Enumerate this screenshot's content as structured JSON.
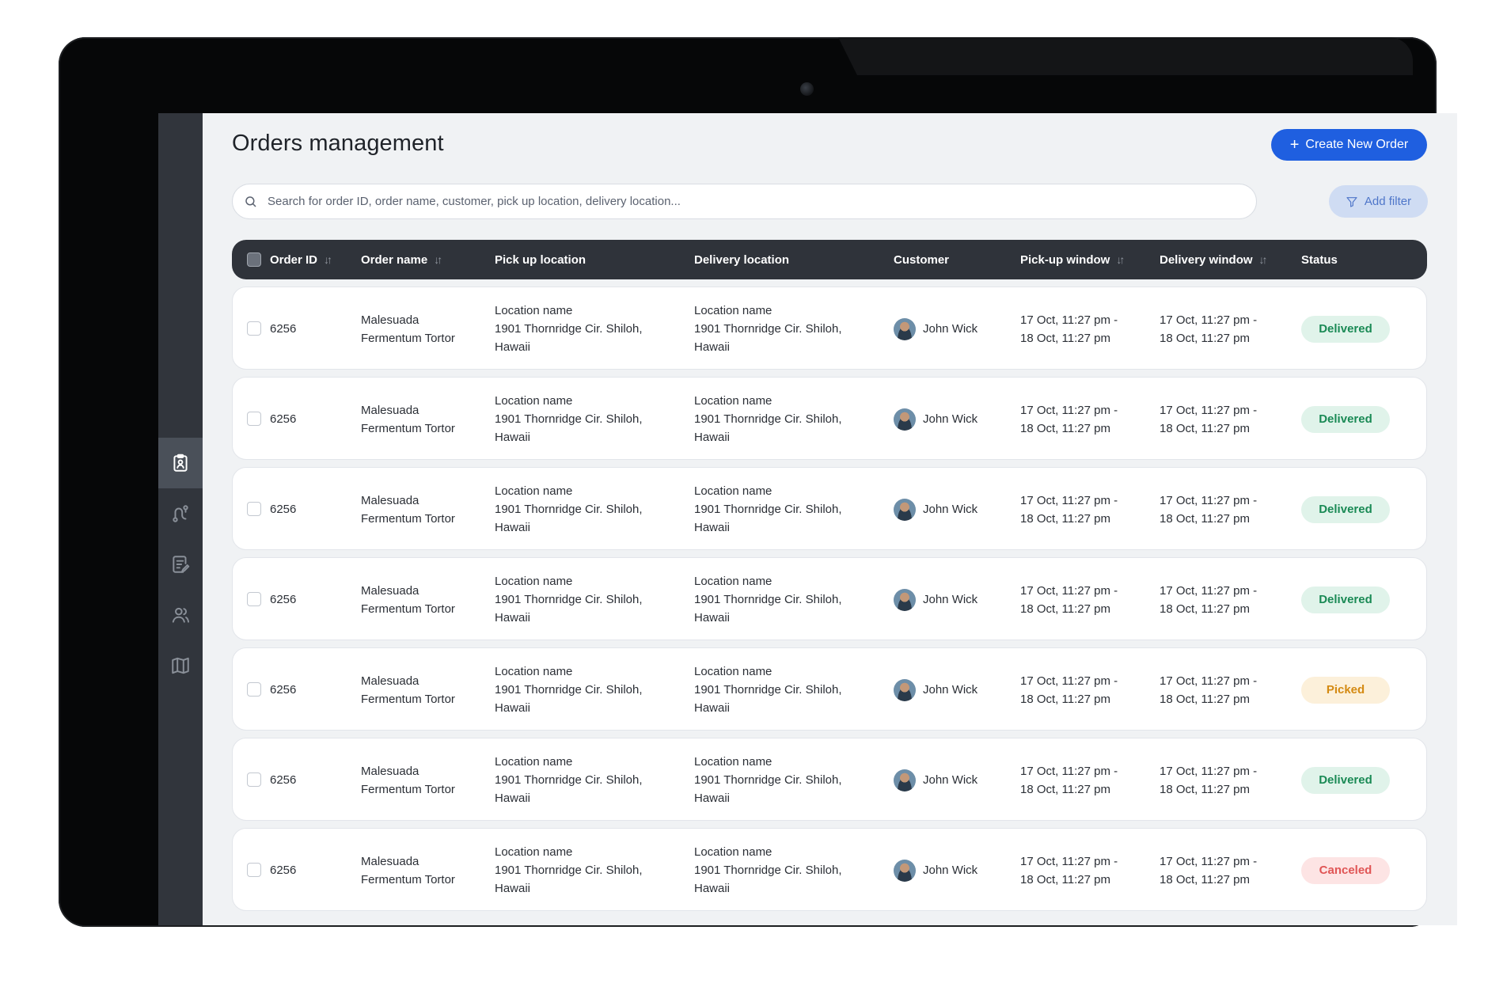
{
  "page": {
    "title": "Orders management",
    "create_button": "Create New Order",
    "search_placeholder": "Search for order ID, order name, customer, pick up location, delivery location...",
    "filter_button": "Add filter"
  },
  "sidebar": {
    "items": [
      {
        "icon": "clipboard-user-icon",
        "active": true
      },
      {
        "icon": "route-icon",
        "active": false
      },
      {
        "icon": "edit-document-icon",
        "active": false
      },
      {
        "icon": "users-icon",
        "active": false
      },
      {
        "icon": "map-icon",
        "active": false
      }
    ]
  },
  "table": {
    "columns": [
      "Order ID",
      "Order name",
      "Pick up location",
      "Delivery location",
      "Customer",
      "Pick-up window",
      "Delivery window",
      "Status"
    ],
    "sortable": [
      "Order ID",
      "Order name",
      "Pick-up window",
      "Delivery window"
    ],
    "rows": [
      {
        "order_id": "6256",
        "name_1": "Malesuada",
        "name_2": "Fermentum Tortor",
        "pickup_1": "Location name",
        "pickup_2": "1901 Thornridge Cir. Shiloh,",
        "pickup_3": "Hawaii",
        "delivery_1": "Location name",
        "delivery_2": "1901 Thornridge Cir. Shiloh,",
        "delivery_3": "Hawaii",
        "customer": "John Wick",
        "pw_1": "17 Oct, 11:27 pm -",
        "pw_2": "18 Oct, 11:27 pm",
        "dw_1": "17 Oct, 11:27 pm -",
        "dw_2": "18 Oct, 11:27 pm",
        "status": "Delivered",
        "status_kind": "delivered"
      },
      {
        "order_id": "6256",
        "name_1": "Malesuada",
        "name_2": "Fermentum Tortor",
        "pickup_1": "Location name",
        "pickup_2": "1901 Thornridge Cir. Shiloh,",
        "pickup_3": "Hawaii",
        "delivery_1": "Location name",
        "delivery_2": "1901 Thornridge Cir. Shiloh,",
        "delivery_3": "Hawaii",
        "customer": "John Wick",
        "pw_1": "17 Oct, 11:27 pm -",
        "pw_2": "18 Oct, 11:27 pm",
        "dw_1": "17 Oct, 11:27 pm -",
        "dw_2": "18 Oct, 11:27 pm",
        "status": "Delivered",
        "status_kind": "delivered"
      },
      {
        "order_id": "6256",
        "name_1": "Malesuada",
        "name_2": "Fermentum Tortor",
        "pickup_1": "Location name",
        "pickup_2": "1901 Thornridge Cir. Shiloh,",
        "pickup_3": "Hawaii",
        "delivery_1": "Location name",
        "delivery_2": "1901 Thornridge Cir. Shiloh,",
        "delivery_3": "Hawaii",
        "customer": "John Wick",
        "pw_1": "17 Oct, 11:27 pm -",
        "pw_2": "18 Oct, 11:27 pm",
        "dw_1": "17 Oct, 11:27 pm -",
        "dw_2": "18 Oct, 11:27 pm",
        "status": "Delivered",
        "status_kind": "delivered"
      },
      {
        "order_id": "6256",
        "name_1": "Malesuada",
        "name_2": "Fermentum Tortor",
        "pickup_1": "Location name",
        "pickup_2": "1901 Thornridge Cir. Shiloh,",
        "pickup_3": "Hawaii",
        "delivery_1": "Location name",
        "delivery_2": "1901 Thornridge Cir. Shiloh,",
        "delivery_3": "Hawaii",
        "customer": "John Wick",
        "pw_1": "17 Oct, 11:27 pm -",
        "pw_2": "18 Oct, 11:27 pm",
        "dw_1": "17 Oct, 11:27 pm -",
        "dw_2": "18 Oct, 11:27 pm",
        "status": "Delivered",
        "status_kind": "delivered"
      },
      {
        "order_id": "6256",
        "name_1": "Malesuada",
        "name_2": "Fermentum Tortor",
        "pickup_1": "Location name",
        "pickup_2": "1901 Thornridge Cir. Shiloh,",
        "pickup_3": "Hawaii",
        "delivery_1": "Location name",
        "delivery_2": "1901 Thornridge Cir. Shiloh,",
        "delivery_3": "Hawaii",
        "customer": "John Wick",
        "pw_1": "17 Oct, 11:27 pm -",
        "pw_2": "18 Oct, 11:27 pm",
        "dw_1": "17 Oct, 11:27 pm -",
        "dw_2": "18 Oct, 11:27 pm",
        "status": "Picked",
        "status_kind": "picked"
      },
      {
        "order_id": "6256",
        "name_1": "Malesuada",
        "name_2": "Fermentum Tortor",
        "pickup_1": "Location name",
        "pickup_2": "1901 Thornridge Cir. Shiloh,",
        "pickup_3": "Hawaii",
        "delivery_1": "Location name",
        "delivery_2": "1901 Thornridge Cir. Shiloh,",
        "delivery_3": "Hawaii",
        "customer": "John Wick",
        "pw_1": "17 Oct, 11:27 pm -",
        "pw_2": "18 Oct, 11:27 pm",
        "dw_1": "17 Oct, 11:27 pm -",
        "dw_2": "18 Oct, 11:27 pm",
        "status": "Delivered",
        "status_kind": "delivered"
      },
      {
        "order_id": "6256",
        "name_1": "Malesuada",
        "name_2": "Fermentum Tortor",
        "pickup_1": "Location name",
        "pickup_2": "1901 Thornridge Cir. Shiloh,",
        "pickup_3": "Hawaii",
        "delivery_1": "Location name",
        "delivery_2": "1901 Thornridge Cir. Shiloh,",
        "delivery_3": "Hawaii",
        "customer": "John Wick",
        "pw_1": "17 Oct, 11:27 pm -",
        "pw_2": "18 Oct, 11:27 pm",
        "dw_1": "17 Oct, 11:27 pm -",
        "dw_2": "18 Oct, 11:27 pm",
        "status": "Canceled",
        "status_kind": "canceled"
      }
    ]
  },
  "colors": {
    "primary": "#1f5fe0",
    "header_bg": "#2f333a",
    "sidebar_bg": "#31353c",
    "delivered": "#1a8a55",
    "picked": "#d48a12",
    "canceled": "#e05555"
  }
}
